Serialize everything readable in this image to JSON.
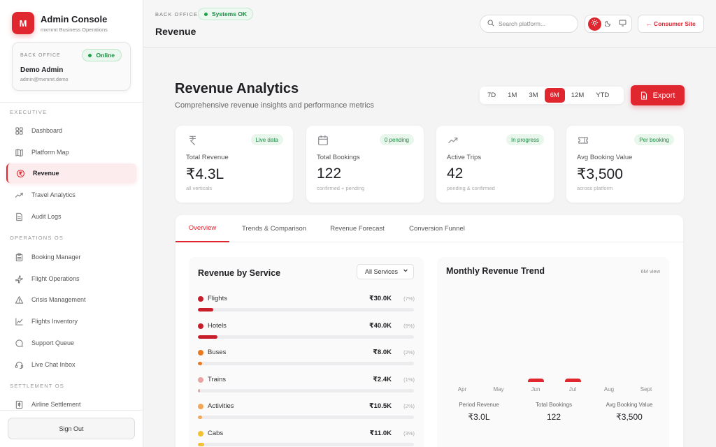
{
  "brand": {
    "logo_letter": "M",
    "title": "Admin Console",
    "subtitle": "mxmmt Business Operations"
  },
  "user_card": {
    "label": "BACK OFFICE",
    "status": "Online",
    "name": "Demo Admin",
    "email": "admin@mxmmt.demo"
  },
  "sidebar": {
    "sections": [
      {
        "label": "EXECUTIVE",
        "items": [
          {
            "label": "Dashboard",
            "icon": "grid-icon"
          },
          {
            "label": "Platform Map",
            "icon": "map-icon"
          },
          {
            "label": "Revenue",
            "icon": "rupee-circle-icon",
            "active": true
          },
          {
            "label": "Travel Analytics",
            "icon": "trend-icon"
          },
          {
            "label": "Audit Logs",
            "icon": "doc-icon"
          }
        ]
      },
      {
        "label": "OPERATIONS OS",
        "items": [
          {
            "label": "Booking Manager",
            "icon": "clipboard-icon"
          },
          {
            "label": "Flight Operations",
            "icon": "plane-icon"
          },
          {
            "label": "Crisis Management",
            "icon": "warning-icon"
          },
          {
            "label": "Flights Inventory",
            "icon": "chart-icon"
          },
          {
            "label": "Support Queue",
            "icon": "chat-icon"
          },
          {
            "label": "Live Chat Inbox",
            "icon": "headset-icon"
          }
        ]
      },
      {
        "label": "SETTLEMENT OS",
        "items": [
          {
            "label": "Airline Settlement",
            "icon": "receipt-icon"
          }
        ]
      }
    ],
    "signout_label": "Sign Out"
  },
  "topbar": {
    "crumb": "BACK OFFICE",
    "status": "Systems OK",
    "title": "Revenue",
    "search_placeholder": "Search platform...",
    "consumer_label": "← Consumer Site"
  },
  "main": {
    "title": "Revenue Analytics",
    "subtitle": "Comprehensive revenue insights and performance metrics",
    "ranges": [
      "7D",
      "1M",
      "3M",
      "6M",
      "12M",
      "YTD"
    ],
    "active_range": "6M",
    "export_label": "Export"
  },
  "stats": [
    {
      "icon": "rupee-icon",
      "badge": "Live data",
      "label": "Total Revenue",
      "value": "₹4.3L",
      "note": "all verticals"
    },
    {
      "icon": "calendar-icon",
      "badge": "0 pending",
      "label": "Total Bookings",
      "value": "122",
      "note": "confirmed + pending"
    },
    {
      "icon": "trend-up-icon",
      "badge": "In progress",
      "label": "Active Trips",
      "value": "42",
      "note": "pending & confirmed"
    },
    {
      "icon": "ticket-icon",
      "badge": "Per booking",
      "label": "Avg Booking Value",
      "value": "₹3,500",
      "note": "across platform"
    }
  ],
  "tabs": [
    "Overview",
    "Trends & Comparison",
    "Revenue Forecast",
    "Conversion Funnel"
  ],
  "revenue_by_service": {
    "title": "Revenue by Service",
    "filter": "All Services",
    "services": [
      {
        "name": "Flights",
        "value": "₹30.0K",
        "pct": "(7%)",
        "share": 7,
        "color": "#c81e2b"
      },
      {
        "name": "Hotels",
        "value": "₹40.0K",
        "pct": "(9%)",
        "share": 9,
        "color": "#c81e2b"
      },
      {
        "name": "Buses",
        "value": "₹8.0K",
        "pct": "(2%)",
        "share": 2,
        "color": "#ea7a22"
      },
      {
        "name": "Trains",
        "value": "₹2.4K",
        "pct": "(1%)",
        "share": 1,
        "color": "#e8a3a3"
      },
      {
        "name": "Activities",
        "value": "₹10.5K",
        "pct": "(2%)",
        "share": 2,
        "color": "#f2a65a"
      },
      {
        "name": "Cabs",
        "value": "₹11.0K",
        "pct": "(3%)",
        "share": 3,
        "color": "#f2c230"
      }
    ]
  },
  "monthly_trend": {
    "title": "Monthly Revenue Trend",
    "view": "6M view",
    "months": [
      "Apr",
      "May",
      "Jun",
      "Jul",
      "Aug",
      "Sept"
    ],
    "summary": [
      {
        "label": "Period Revenue",
        "value": "₹3.0L"
      },
      {
        "label": "Total Bookings",
        "value": "122"
      },
      {
        "label": "Avg Booking Value",
        "value": "₹3,500"
      }
    ]
  },
  "chart_data": {
    "type": "bar",
    "title": "Monthly Revenue Trend",
    "categories": [
      "Apr",
      "May",
      "Jun",
      "Jul",
      "Aug",
      "Sept"
    ],
    "values": [
      0,
      0,
      1,
      1,
      0,
      0
    ],
    "ylim": [
      0,
      1
    ],
    "grid": false
  },
  "colors": {
    "accent": "#e0262f",
    "success": "#1e8a44"
  }
}
